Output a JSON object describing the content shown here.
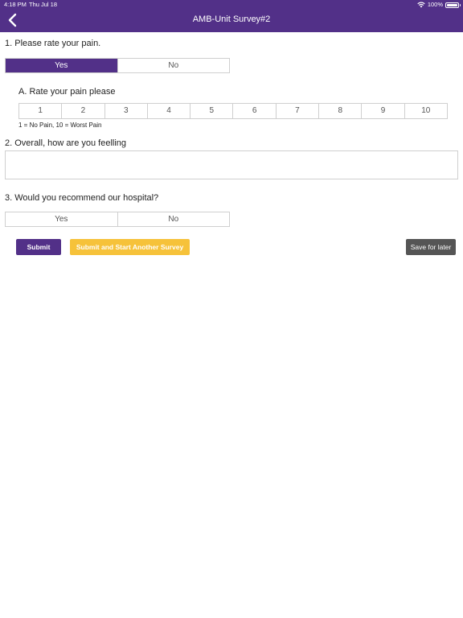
{
  "status_bar": {
    "time": "4:18 PM",
    "date": "Thu Jul 18",
    "battery": "100%",
    "battery_level": 1.0
  },
  "header": {
    "title": "AMB-Unit Survey#2",
    "back_icon": "chevron-left-icon"
  },
  "questions": {
    "q1": {
      "text": "1. Please rate your pain.",
      "options": [
        "Yes",
        "No"
      ],
      "selected": "Yes",
      "sub": {
        "text": "A. Rate your pain please",
        "scale": [
          "1",
          "2",
          "3",
          "4",
          "5",
          "6",
          "7",
          "8",
          "9",
          "10"
        ],
        "hint": "1 =  No Pain, 10 = Worst Pain"
      }
    },
    "q2": {
      "text": "2. Overall, how are you feelling",
      "value": ""
    },
    "q3": {
      "text": "3. Would you recommend our hospital?",
      "options": [
        "Yes",
        "No"
      ],
      "selected": ""
    }
  },
  "actions": {
    "submit": "Submit",
    "submit_another": "Submit and Start Another Survey",
    "save_later": "Save for later"
  },
  "colors": {
    "primary": "#523088",
    "accent": "#f6c23a",
    "secondary": "#555555"
  }
}
